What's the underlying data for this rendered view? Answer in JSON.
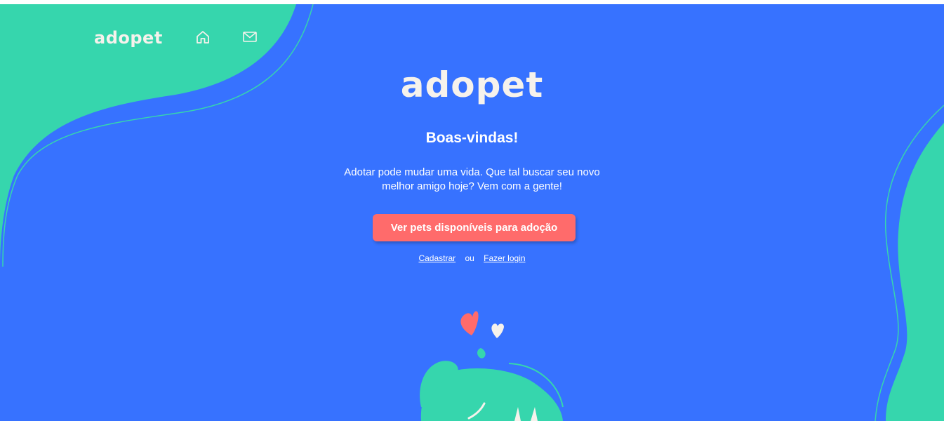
{
  "header": {
    "logo_text": "adopet",
    "nav": [
      {
        "icon": "home-icon"
      },
      {
        "icon": "mail-icon"
      }
    ]
  },
  "main": {
    "logo_text": "adopet",
    "title": "Boas-vindas!",
    "subtitle": "Adotar pode mudar uma vida. Que tal buscar seu novo melhor amigo hoje? Vem com a gente!",
    "cta_label": "Ver pets disponíveis para adoção",
    "register_link": "Cadastrar",
    "separator": "ou",
    "login_link": "Fazer login"
  },
  "colors": {
    "background": "#3772FF",
    "accent_green": "#36D6AD",
    "button": "#FF6B6B",
    "logo": "#F6F2EC"
  }
}
